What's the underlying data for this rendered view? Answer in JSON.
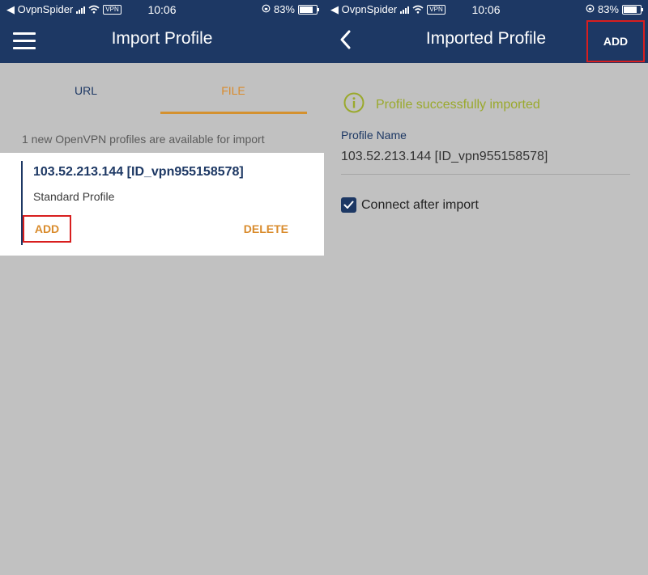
{
  "status_bar": {
    "carrier": "◀ OvpnSpider",
    "vpn_badge": "VPN",
    "time": "10:06",
    "battery_pct": "83%"
  },
  "left": {
    "title": "Import Profile",
    "tabs": [
      {
        "label": "URL",
        "selected": false
      },
      {
        "label": "FILE",
        "selected": true
      }
    ],
    "available_text": "1 new OpenVPN profiles are available for import",
    "profile_card": {
      "title": "103.52.213.144 [ID_vpn955158578]",
      "subtitle": "Standard Profile",
      "add_label": "ADD",
      "delete_label": "DELETE"
    },
    "icons": [
      "hamburger-menu-icon"
    ]
  },
  "right": {
    "title": "Imported Profile",
    "add_label": "ADD",
    "success_text": "Profile successfully imported",
    "profile_name_label": "Profile Name",
    "profile_name_value": "103.52.213.144 [ID_vpn955158578]",
    "connect_after_import": {
      "label": "Connect after import",
      "checked": true
    },
    "icons": [
      "back-chevron-icon",
      "info-icon",
      "checkbox-icon"
    ]
  },
  "colors": {
    "header": "#1d3864",
    "accent_orange": "#d98b2c",
    "highlight_red": "#d81e1e",
    "success_green": "#9aa92c",
    "background_gray": "#c1c1c1"
  }
}
